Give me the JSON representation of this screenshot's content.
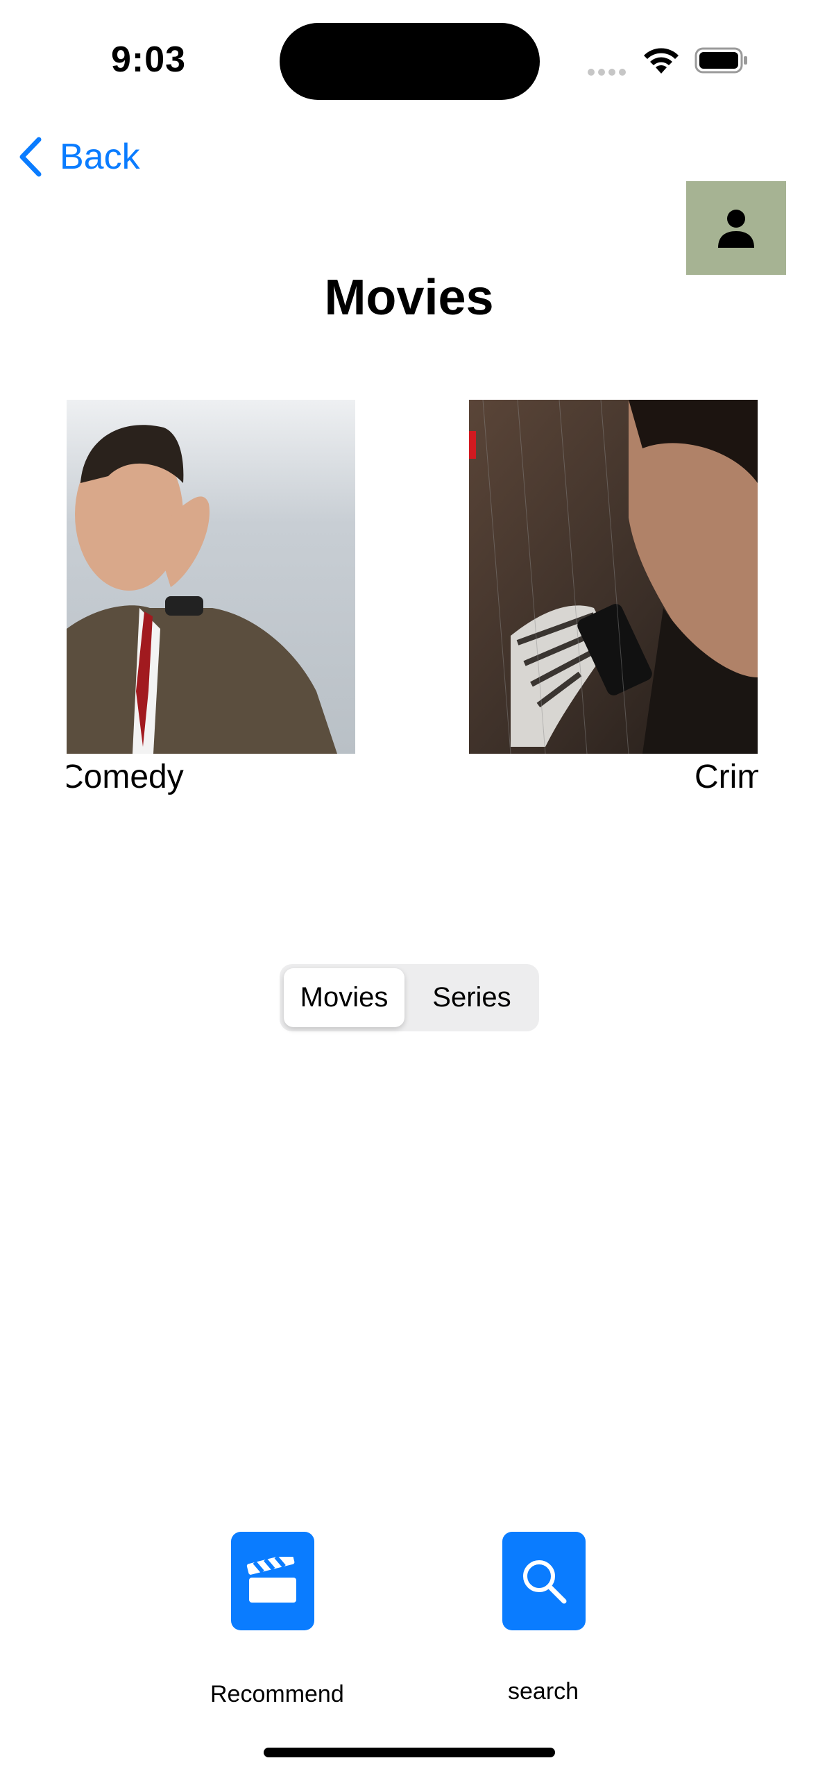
{
  "status_bar": {
    "time": "9:03"
  },
  "nav": {
    "back_label": "Back"
  },
  "header": {
    "title": "Movies"
  },
  "carousel": {
    "items": [
      {
        "caption": "Comedy"
      },
      {
        "caption": "Crim"
      }
    ]
  },
  "segmented": {
    "options": [
      "Movies",
      "Series"
    ],
    "selected": "Movies"
  },
  "tabs": [
    {
      "label": "Recommend",
      "icon": "clapperboard-icon"
    },
    {
      "label": "search",
      "icon": "search-icon"
    }
  ],
  "colors": {
    "accent": "#0a7cff",
    "profile_bg": "#a6b393",
    "segment_bg": "#ededee"
  }
}
